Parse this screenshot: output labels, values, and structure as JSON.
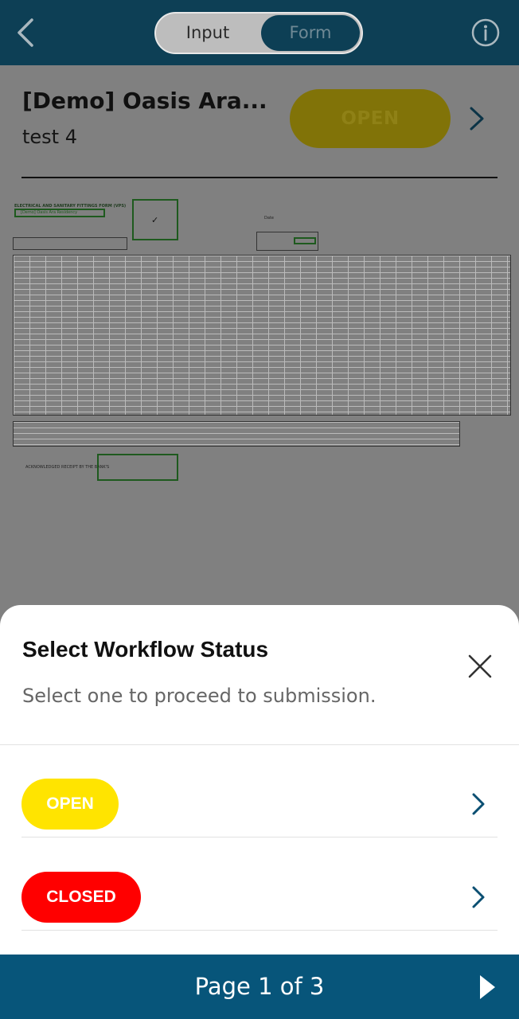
{
  "topbar": {
    "back_icon": "chevron-left-icon",
    "tabs": [
      {
        "label": "Input",
        "active": false
      },
      {
        "label": "Form",
        "active": true
      }
    ],
    "info_icon": "info-icon"
  },
  "form": {
    "title": "[Demo] Oasis Ara...",
    "subtitle": "test 4",
    "status": "OPEN"
  },
  "document": {
    "heading": "ELECTRICAL AND SANITARY FITTINGS FORM (VPS)",
    "project": "[Demo] Oasis Ara Residency",
    "check": "✓",
    "date_label": "Date",
    "signature_label": "ACKNOWLEDGED RECEIPT BY THE BANK'S"
  },
  "sheet": {
    "title": "Select Workflow Status",
    "subtitle": "Select one to proceed to submission.",
    "options": [
      {
        "label": "OPEN",
        "color": "#ffe400"
      },
      {
        "label": "CLOSED",
        "color": "#ff0000"
      }
    ]
  },
  "footer": {
    "page_label": "Page 1 of 3"
  }
}
